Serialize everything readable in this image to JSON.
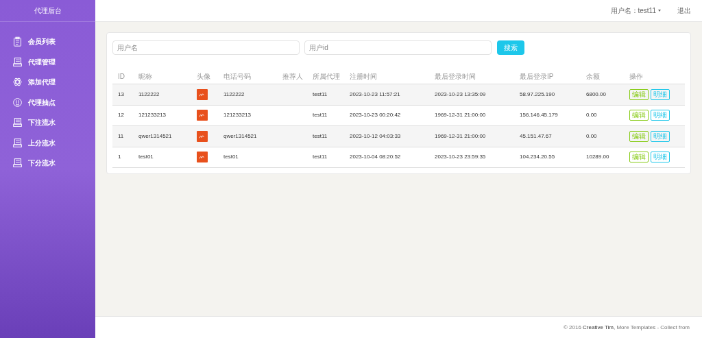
{
  "sidebar": {
    "title": "代理后台",
    "items": [
      {
        "label": "会员列表",
        "selected": false
      },
      {
        "label": "代理管理",
        "selected": false
      },
      {
        "label": "添加代理",
        "selected": false
      },
      {
        "label": "代理抽点",
        "selected": false
      },
      {
        "label": "下注流水",
        "selected": false
      },
      {
        "label": "上分流水",
        "selected": false
      },
      {
        "label": "下分流水",
        "selected": false
      }
    ]
  },
  "topbar": {
    "user": "用户名：test11",
    "logout": "退出"
  },
  "search": {
    "fields": [
      {
        "placeholder": "用户名"
      },
      {
        "placeholder": "用户id"
      }
    ],
    "button": "搜索"
  },
  "table": {
    "columns": [
      "ID",
      "昵称",
      "头像",
      "电话号码",
      "推荐人",
      "所属代理",
      "注册时间",
      "最后登录时间",
      "最后登录IP",
      "余额",
      "操作"
    ],
    "rows": [
      {
        "id": "13",
        "nickname": "1122222",
        "phone": "1122222",
        "agent": "test11",
        "registered": "2023-10-23 11:57:21",
        "last_login": "2023-10-23 13:35:09",
        "ip": "58.97.225.190",
        "balance": "6800.00",
        "edit": "编辑",
        "detail": "明细"
      },
      {
        "id": "12",
        "nickname": "121233213",
        "phone": "121233213",
        "agent": "test11",
        "registered": "2023-10-23 00:20:42",
        "last_login": "1969-12-31 21:00:00",
        "ip": "156.146.45.179",
        "balance": "0.00",
        "edit": "编辑",
        "detail": "明细"
      },
      {
        "id": "11",
        "nickname": "qwer1314521",
        "phone": "qwer1314521",
        "agent": "test11",
        "registered": "2023-10-12 04:03:33",
        "last_login": "1969-12-31 21:00:00",
        "ip": "45.151.47.67",
        "balance": "0.00",
        "edit": "编辑",
        "detail": "明细"
      },
      {
        "id": "1",
        "nickname": "test01",
        "phone": "test01",
        "agent": "test11",
        "registered": "2023-10-04 08:20:52",
        "last_login": "2023-10-23 23:59:35",
        "ip": "104.234.20.55",
        "balance": "10289.00",
        "edit": "编辑",
        "detail": "明细"
      }
    ]
  },
  "footer": {
    "text_before": "© 2016",
    "link": "Creative Tim",
    "text_after": ", More Templates - Collect from"
  }
}
